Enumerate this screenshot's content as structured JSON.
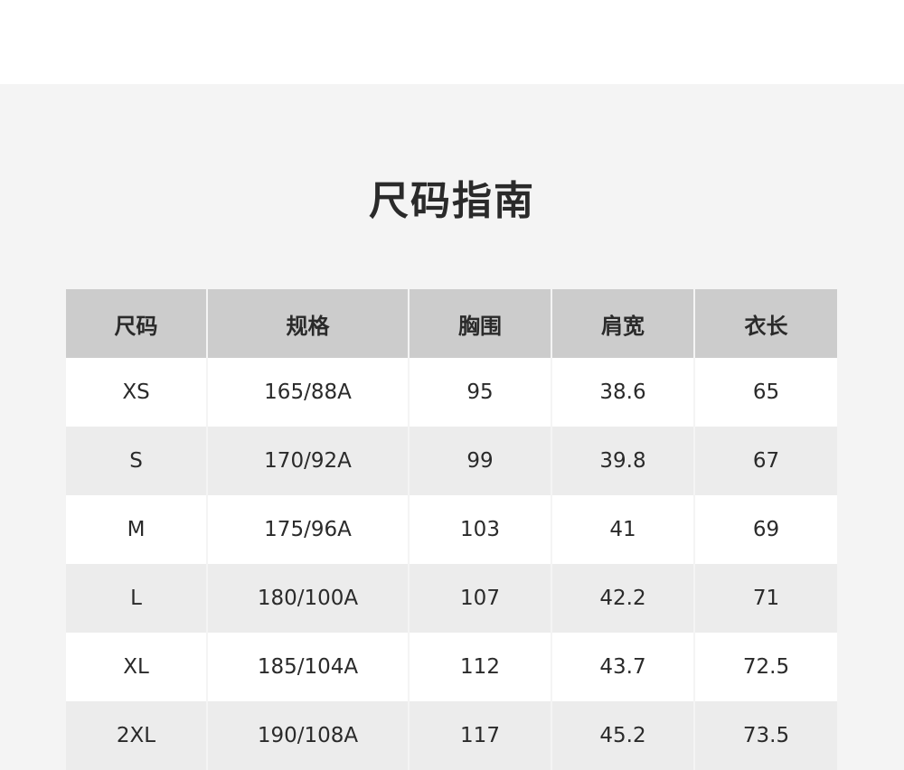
{
  "title": "尺码指南",
  "table": {
    "headers": [
      "尺码",
      "规格",
      "胸围",
      "肩宽",
      "衣长"
    ],
    "rows": [
      [
        "XS",
        "165/88A",
        "95",
        "38.6",
        "65"
      ],
      [
        "S",
        "170/92A",
        "99",
        "39.8",
        "67"
      ],
      [
        "M",
        "175/96A",
        "103",
        "41",
        "69"
      ],
      [
        "L",
        "180/100A",
        "107",
        "42.2",
        "71"
      ],
      [
        "XL",
        "185/104A",
        "112",
        "43.7",
        "72.5"
      ],
      [
        "2XL",
        "190/108A",
        "117",
        "45.2",
        "73.5"
      ]
    ]
  },
  "colors": {
    "panel_background": "#f4f4f4",
    "header_background": "#cccccc",
    "row_odd": "#ffffff",
    "row_even": "#ececec",
    "text": "#2a2a2a"
  }
}
